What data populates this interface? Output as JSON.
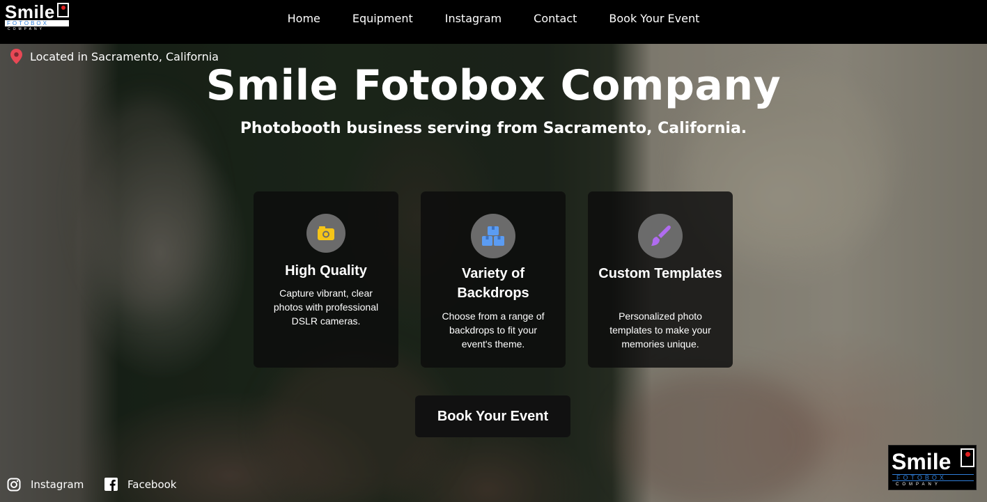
{
  "brand": {
    "logo_word": "Smile",
    "logo_band": "FOTOBOX",
    "logo_sub": "COMPANY"
  },
  "nav": {
    "items": [
      {
        "label": "Home"
      },
      {
        "label": "Equipment"
      },
      {
        "label": "Instagram"
      },
      {
        "label": "Contact"
      },
      {
        "label": "Book Your Event"
      }
    ]
  },
  "location": {
    "text": "Located in Sacramento, California",
    "icon": "map-pin-icon",
    "icon_color": "#e84855"
  },
  "hero": {
    "title": "Smile Fotobox Company",
    "subtitle": "Photobooth business serving from Sacramento, California."
  },
  "features": [
    {
      "title": "High Quality",
      "description": "Capture vibrant, clear photos with professional DSLR cameras.",
      "icon": "camera-icon",
      "icon_color": "#f5c518"
    },
    {
      "title": "Variety of Backdrops",
      "description": "Choose from a range of backdrops to fit your event's theme.",
      "icon": "boxes-icon",
      "icon_color": "#5b9cf2"
    },
    {
      "title": "Custom Templates",
      "description": "Personalized photo templates to make your memories unique.",
      "icon": "paintbrush-icon",
      "icon_color": "#b06cf0"
    }
  ],
  "cta": {
    "label": "Book Your Event"
  },
  "social": {
    "instagram": "Instagram",
    "facebook": "Facebook"
  }
}
